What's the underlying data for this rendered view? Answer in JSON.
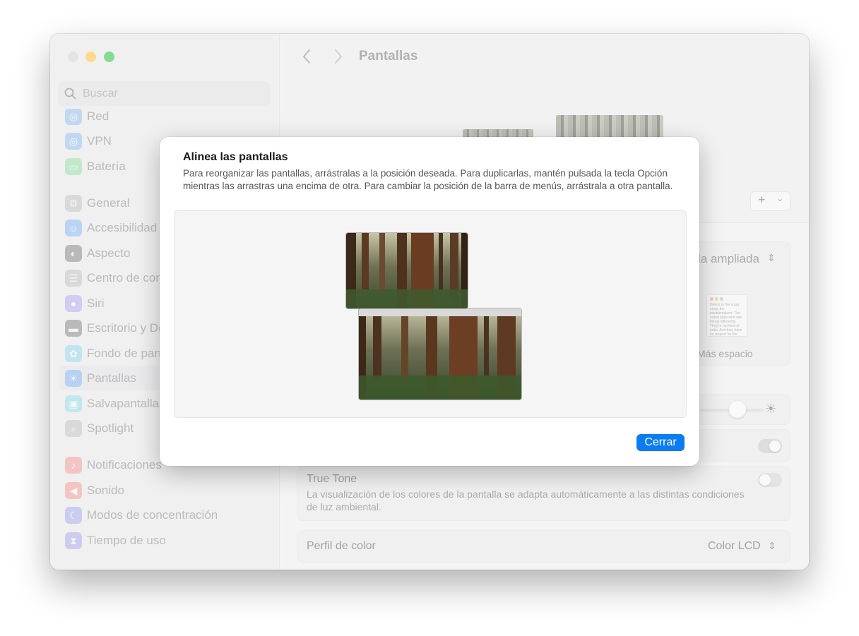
{
  "window": {
    "title": "Pantallas"
  },
  "sidebar": {
    "search_placeholder": "Buscar",
    "items": [
      {
        "label": "Red",
        "icon": "globe-icon",
        "color": "#3a8cf0"
      },
      {
        "label": "VPN",
        "icon": "vpn-globe-icon",
        "color": "#3a8cf0"
      },
      {
        "label": "Batería",
        "icon": "battery-icon",
        "color": "#35c759"
      },
      {
        "label": "General",
        "icon": "gear-icon",
        "color": "#8e8e93"
      },
      {
        "label": "Accesibilidad",
        "icon": "accessibility-icon",
        "color": "#1a7cf4"
      },
      {
        "label": "Aspecto",
        "icon": "appearance-icon",
        "color": "#1c1c1e"
      },
      {
        "label": "Centro de control",
        "icon": "control-center-icon",
        "color": "#8e8e93"
      },
      {
        "label": "Siri",
        "icon": "siri-icon",
        "color": "#6e5df0"
      },
      {
        "label": "Escritorio y Dock",
        "icon": "dock-icon",
        "color": "#1c1c1e"
      },
      {
        "label": "Fondo de pantalla",
        "icon": "wallpaper-icon",
        "color": "#35b8f0"
      },
      {
        "label": "Pantallas",
        "icon": "display-sun-icon",
        "color": "#1a7cf4"
      },
      {
        "label": "Salvapantallas",
        "icon": "screensaver-icon",
        "color": "#35c7d9"
      },
      {
        "label": "Spotlight",
        "icon": "spotlight-icon",
        "color": "#8e8e93"
      },
      {
        "label": "Notificaciones",
        "icon": "bell-icon",
        "color": "#f0453a"
      },
      {
        "label": "Sonido",
        "icon": "speaker-icon",
        "color": "#f0453a"
      },
      {
        "label": "Modos de concentración",
        "icon": "moon-icon",
        "color": "#5e5ce6"
      },
      {
        "label": "Tiempo de uso",
        "icon": "hourglass-icon",
        "color": "#5e5ce6"
      }
    ],
    "selected": "Pantallas"
  },
  "background": {
    "resolution_value": "la ampliada",
    "more_space_label": "Más espacio",
    "true_tone_label": "True Tone",
    "true_tone_desc": "La visualización de los colores de la pantalla se adapta automáticamente a las distintas condiciones de luz ambiental.",
    "color_profile_label": "Perfil de color",
    "color_profile_value": "Color LCD",
    "preview_text": "Here's to the crazy ones, the troublemakers. The round pegs who see things differently. They're not fond of rules. And they have no respect for the status quo. You can quote them, disagree with them, glorify or vilify them. About the only thing you can't do is ignore them. Because they change things."
  },
  "dialog": {
    "title": "Alinea las pantallas",
    "description": "Para reorganizar las pantallas, arrástralas a la posición deseada. Para duplicarlas, mantén pulsada la tecla Opción mientras las arrastras una encima de otra. Para cambiar la posición de la barra de menús, arrástrala a otra pantalla.",
    "close_label": "Cerrar",
    "accent_color": "#0c7cf3"
  }
}
